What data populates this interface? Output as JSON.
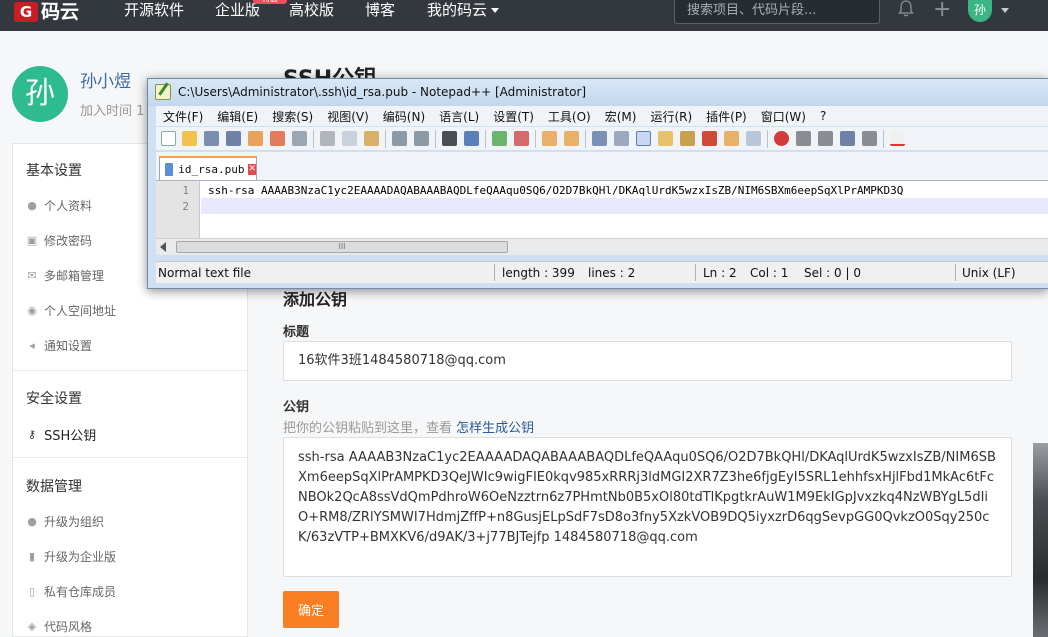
{
  "topnav": {
    "logo_mark": "G",
    "logo_text": "码云",
    "links": [
      "开源软件",
      "企业版",
      "高校版",
      "博客",
      "我的码云"
    ],
    "badge": "特惠",
    "search_placeholder": "搜索项目、代码片段...",
    "plus": "+",
    "avatar": "孙"
  },
  "profile": {
    "avatar": "孙",
    "name": "孙小煜",
    "join": "加入时间 1"
  },
  "sidebar": {
    "sections": [
      {
        "title": "基本设置",
        "items": [
          {
            "label": "个人资料",
            "icon": "user-icon"
          },
          {
            "label": "修改密码",
            "icon": "lock-icon"
          },
          {
            "label": "多邮箱管理",
            "icon": "envelope-icon"
          },
          {
            "label": "个人空间地址",
            "icon": "compass-icon"
          },
          {
            "label": "通知设置",
            "icon": "speaker-icon"
          }
        ]
      },
      {
        "title": "安全设置",
        "items": [
          {
            "label": "SSH公钥",
            "icon": "key-icon",
            "active": true
          }
        ]
      },
      {
        "title": "数据管理",
        "items": [
          {
            "label": "升级为组织",
            "icon": "group-icon"
          },
          {
            "label": "升级为企业版",
            "icon": "building-icon"
          },
          {
            "label": "私有仓库成员",
            "icon": "repo-icon"
          },
          {
            "label": "代码风格",
            "icon": "palette-icon"
          }
        ]
      }
    ]
  },
  "main": {
    "page_title": "SSH公钥",
    "section_title": "添加公钥",
    "title_label": "标题",
    "title_value": "16软件3班1484580718@qq.com",
    "key_label": "公钥",
    "key_hint": "把你的公钥粘贴到这里，查看 ",
    "key_hint_link": "怎样生成公钥",
    "key_value": "ssh-rsa AAAAB3NzaC1yc2EAAAADAQABAAABAQDLfeQAAqu0SQ6/O2D7BkQHl/DKAqlUrdK5wzxIsZB/NIM6SBXm6eepSqXlPrAMPKD3QeJWIc9wigFIE0kqv985xRRRj3ldMGI2XR7Z3he6fjgEyI5SRL1ehhfsxHjlFbd1MkAc6tFcNBOk2QcA8ssVdQmPdhroW6OeNzztrn6z7PHmtNb0B5xOl80tdTlKpgtkrAuW1M9EkIGpJvxzkq4NzWBYgL5dIiO+RM8/ZRlYSMWI7HdmjZffP+n8GusjELpSdF7sD8o3fny5XzkVOB9DQ5iyxzrD6qgSevpGG0QvkzO0Sqy250cK/63zVTP+BMXKV6/d9AK/3+j77BJTejfp 1484580718@qq.com",
    "confirm": "确定"
  },
  "notepad": {
    "title": "C:\\Users\\Administrator\\.ssh\\id_rsa.pub - Notepad++ [Administrator]",
    "menus": [
      "文件(F)",
      "编辑(E)",
      "搜索(S)",
      "视图(V)",
      "编码(N)",
      "语言(L)",
      "设置(T)",
      "工具(O)",
      "宏(M)",
      "运行(R)",
      "插件(P)",
      "窗口(W)",
      "?"
    ],
    "tab": "id_rsa.pub",
    "line_numbers": [
      "1",
      "2"
    ],
    "line1": "ssh-rsa AAAAB3NzaC1yc2EAAAADAQABAAABAQDLfeQAAqu0SQ6/O2D7BkQHl/DKAqlUrdK5wzxIsZB/NIM6SBXm6eepSqXlPrAMPKD3Q",
    "status": {
      "type": "Normal text file",
      "length": "length : 399",
      "lines": "lines : 2",
      "ln": "Ln : 2",
      "col": "Col : 1",
      "sel": "Sel : 0 | 0",
      "eol": "Unix (LF)"
    },
    "scroll_thumb": "III"
  },
  "colors": {
    "nav_bg": "#32383e",
    "brand_red": "#c71d23",
    "avatar_green": "#2ebc8e",
    "confirm_orange": "#fa7d22",
    "link_blue": "#2a5a9a"
  }
}
